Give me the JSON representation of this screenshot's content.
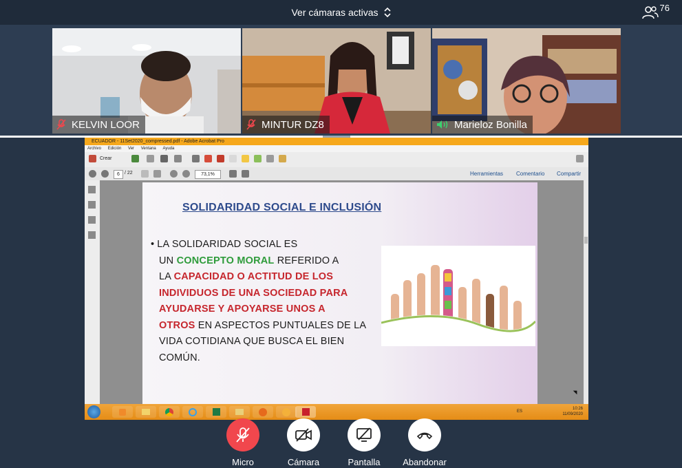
{
  "header": {
    "view_selector_label": "Ver cámaras activas",
    "participant_count": "76"
  },
  "participants": [
    {
      "name": "KELVIN LOOR",
      "mic": "muted"
    },
    {
      "name": "MINTUR DZ8",
      "mic": "muted"
    },
    {
      "name": "Marieloz Bonilla",
      "mic": "active"
    }
  ],
  "shared_screen": {
    "window_title": "ECUADOR - 11Set2020_compressed.pdf - Adobe Acrobat Pro",
    "menu": [
      "Archivo",
      "Edición",
      "Ver",
      "Ventana",
      "Ayuda"
    ],
    "toolbar": {
      "create_label": "Crear",
      "page_current": "6",
      "page_total": "/ 22",
      "zoom": "73,1%",
      "tools_label": "Herramientas",
      "comment_label": "Comentario",
      "share_label": "Compartir"
    },
    "slide": {
      "title": "SOLIDARIDAD SOCIAL E INCLUSIÓN",
      "bullet": "•",
      "text_1": "LA SOLIDARIDAD SOCIAL ES",
      "text_2": "UN",
      "text_green": "CONCEPTO MORAL",
      "text_3": "REFERIDO A",
      "text_4": "LA",
      "text_red_1": "CAPACIDAD O ACTITUD DE LOS",
      "text_red_2": "INDIVIDUOS DE UNA SOCIEDAD PARA",
      "text_red_3": "AYUDARSE Y APOYARSE UNOS A",
      "text_red_4": "OTROS",
      "text_5": "EN ASPECTOS PUNTUALES DE LA",
      "text_6": "VIDA COTIDIANA QUE BUSCA EL BIEN",
      "text_7": "COMÚN."
    },
    "taskbar": {
      "lang": "ES",
      "time": "10:26",
      "date": "11/09/2020"
    }
  },
  "controls": {
    "mic_label": "Micro",
    "camera_label": "Cámara",
    "screen_label": "Pantalla",
    "leave_label": "Abandonar"
  },
  "colors": {
    "background": "#263446",
    "mic_button": "#f1474d",
    "slide_title": "#2e4b8c",
    "slide_green": "#2e9b3a",
    "slide_red": "#c6262d"
  }
}
